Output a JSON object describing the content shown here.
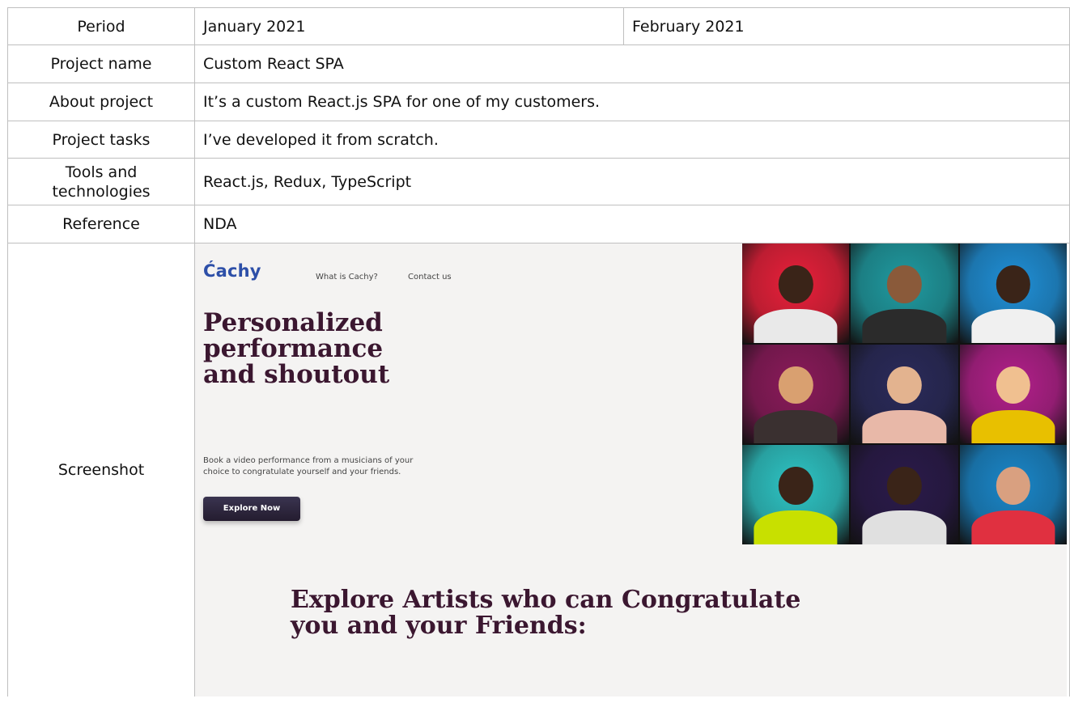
{
  "rows": {
    "period": {
      "label": "Period",
      "start": "January 2021",
      "end": "February 2021"
    },
    "project_name": {
      "label": "Project name",
      "value": "Custom React SPA"
    },
    "about_project": {
      "label": "About project",
      "value": "It’s a custom React.js SPA for one of my customers."
    },
    "project_tasks": {
      "label": "Project tasks",
      "value": "I’ve developed it from scratch."
    },
    "tools": {
      "label_line1": "Tools and",
      "label_line2": "technologies",
      "value": "React.js, Redux, TypeScript"
    },
    "reference": {
      "label": "Reference",
      "value": "NDA"
    },
    "screenshot": {
      "label": "Screenshot"
    }
  },
  "site": {
    "logo": "Ćachy",
    "nav": [
      "What is Cachy?",
      "Contact us"
    ],
    "hero_title": [
      "Personalized",
      "performance",
      "and shoutout"
    ],
    "hero_subtitle_line1": "Book a video performance from a musicians of your",
    "hero_subtitle_line2": "choice to congratulate yourself and your friends.",
    "cta": "Explore Now",
    "section_title_line1": "Explore Artists who can Congratulate",
    "section_title_line2": "you and your Friends:",
    "photo_tiles": [
      {
        "bg": "#e8203a",
        "skin": "#3a2418",
        "shirt": "#e9e9e9"
      },
      {
        "bg": "#1f9aa0",
        "skin": "#8a5a3a",
        "shirt": "#2b2b2b"
      },
      {
        "bg": "#1f8fd6",
        "skin": "#3a2418",
        "shirt": "#f0f0f0"
      },
      {
        "bg": "#8a1a5a",
        "skin": "#d9a070",
        "shirt": "#3a3030"
      },
      {
        "bg": "#2a2a5a",
        "skin": "#e3b38f",
        "shirt": "#e8b8a8"
      },
      {
        "bg": "#b2208a",
        "skin": "#f0c090",
        "shirt": "#e8c000"
      },
      {
        "bg": "#2ec4c4",
        "skin": "#3a2418",
        "shirt": "#c8e000"
      },
      {
        "bg": "#2a1a4a",
        "skin": "#3a2418",
        "shirt": "#e0e0e0"
      },
      {
        "bg": "#1a86c8",
        "skin": "#d9a080",
        "shirt": "#e03040"
      }
    ]
  }
}
